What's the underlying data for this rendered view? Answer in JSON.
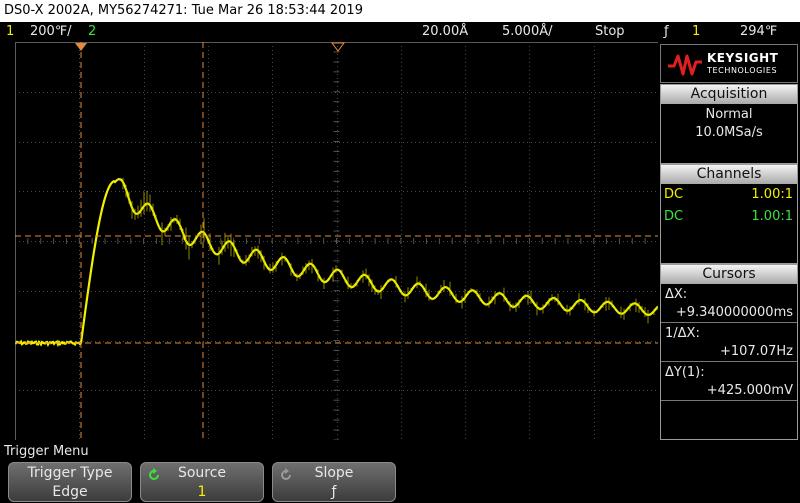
{
  "title_bar": "DS0-X 2002A, MY56274271: Tue Mar 26 18:53:44 2019",
  "status": {
    "ch1_num": "1",
    "ch1_scale": "200℉/",
    "ch2_num": "2",
    "timebase": "20.00Å",
    "delay": "5.000Å/",
    "run_state": "Stop",
    "trig_slope": "ƒ",
    "trig_src": "1",
    "trig_level": "294℉"
  },
  "brand": {
    "name": "KEYSIGHT",
    "sub": "TECHNOLOGIES"
  },
  "acquisition": {
    "header": "Acquisition",
    "mode": "Normal",
    "rate": "10.0MSa/s"
  },
  "channels": {
    "header": "Channels",
    "rows": [
      {
        "coupling": "DC",
        "probe": "1.00:1"
      },
      {
        "coupling": "DC",
        "probe": "1.00:1"
      }
    ]
  },
  "cursors": {
    "header": "Cursors",
    "dx_label": "ΔX:",
    "dx_value": "+9.340000000ms",
    "inv_label": "1/ΔX:",
    "inv_value": "+107.07Hz",
    "dy_label": "ΔY(1):",
    "dy_value": "+425.000mV"
  },
  "bottom": {
    "menu_title": "Trigger Menu",
    "softkeys": [
      {
        "label": "Trigger Type",
        "value": "Edge"
      },
      {
        "label": "Source",
        "value": "1"
      },
      {
        "label": "Slope",
        "value": "ƒ"
      }
    ]
  },
  "markers": {
    "trig_level": "T",
    "ch1_ground": "1"
  },
  "colors": {
    "ch1": "#f2f200",
    "ch2": "#3ee03e",
    "cursor": "#e58a3a",
    "grid": "#5a5a5a"
  },
  "waveform": {
    "steady_state_after_rise": "decaying ripple",
    "cursor_delta_x_ms": 9.34,
    "cursor_delta_y_mv": 425
  }
}
